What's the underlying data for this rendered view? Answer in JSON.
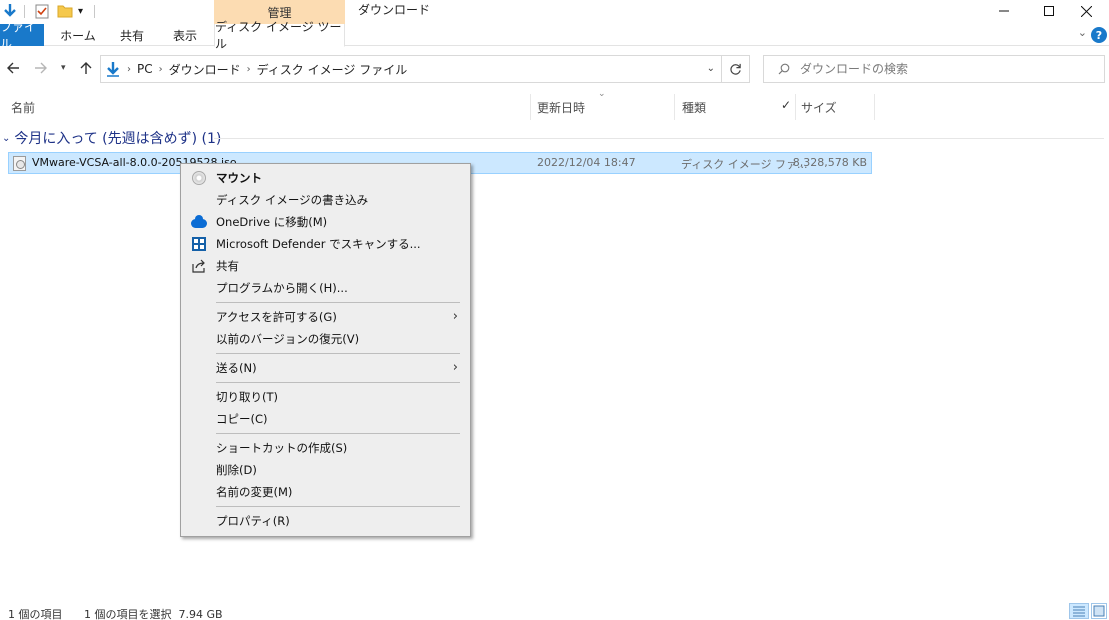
{
  "window": {
    "title": "ダウンロード",
    "contextual_tab_header": "管理"
  },
  "ribbon": {
    "tabs": [
      "ファイル",
      "ホーム",
      "共有",
      "表示",
      "ディスク イメージ ツール"
    ]
  },
  "address": {
    "path": [
      "PC",
      "ダウンロード",
      "ディスク イメージ ファイル"
    ]
  },
  "search": {
    "placeholder": "ダウンロードの検索"
  },
  "columns": {
    "name": "名前",
    "date": "更新日時",
    "type": "種類",
    "size": "サイズ"
  },
  "group": {
    "label": "今月に入って (先週は含めず) (1)"
  },
  "file": {
    "name": "VMware-VCSA-all-8.0.0-20519528.iso",
    "date": "2022/12/04 18:47",
    "type": "ディスク イメージ ファ...",
    "size": "8,328,578 KB"
  },
  "context_menu": {
    "mount": "マウント",
    "burn": "ディスク イメージの書き込み",
    "onedrive": "OneDrive に移動(M)",
    "defender": "Microsoft Defender でスキャンする...",
    "share": "共有",
    "open_with": "プログラムから開く(H)...",
    "give_access": "アクセスを許可する(G)",
    "restore": "以前のバージョンの復元(V)",
    "send_to": "送る(N)",
    "cut": "切り取り(T)",
    "copy": "コピー(C)",
    "shortcut": "ショートカットの作成(S)",
    "delete": "削除(D)",
    "rename": "名前の変更(M)",
    "properties": "プロパティ(R)"
  },
  "status": {
    "count": "1 個の項目",
    "selected": "1 個の項目を選択  7.94 GB"
  },
  "colors": {
    "accent": "#1979ca",
    "selection": "#cce8ff",
    "manage_tab": "#fcdcb2",
    "group_header": "#1e3287"
  }
}
